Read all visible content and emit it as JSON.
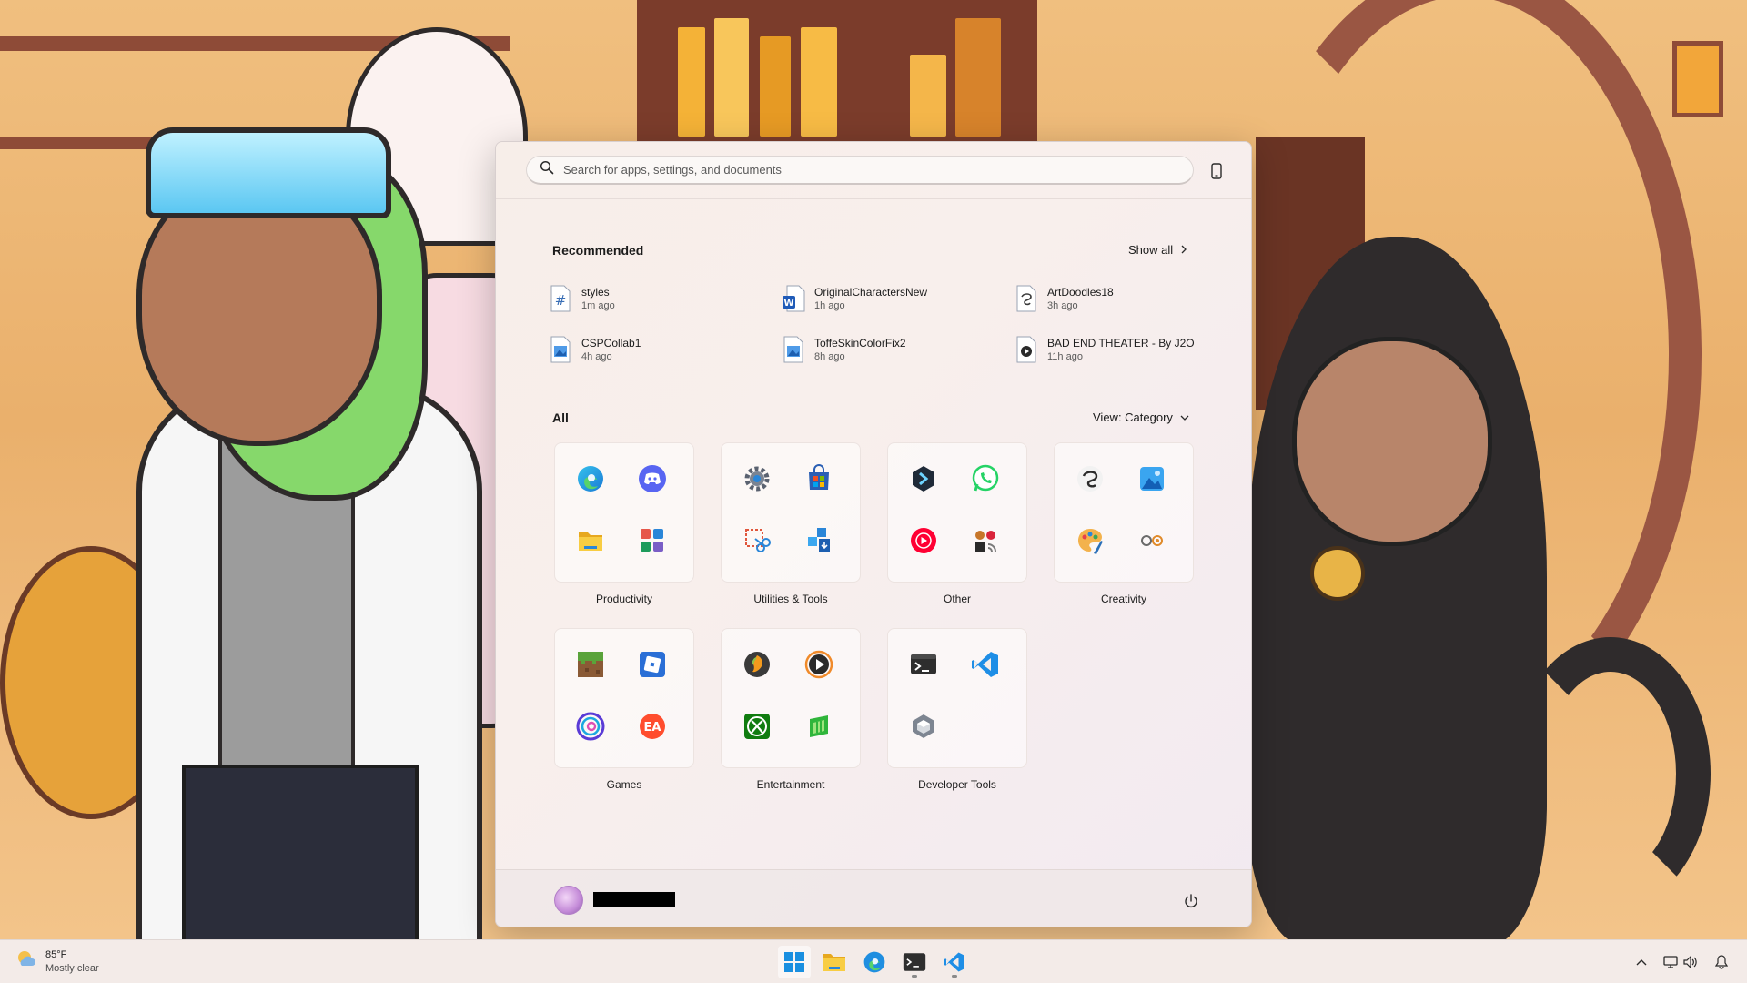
{
  "search": {
    "placeholder": "Search for apps, settings, and documents"
  },
  "recommended": {
    "title": "Recommended",
    "show_all_label": "Show all",
    "items": [
      {
        "name": "styles",
        "time": "1m ago",
        "icon": "hash-file-icon"
      },
      {
        "name": "OriginalCharactersNew",
        "time": "1h ago",
        "icon": "word-document-icon"
      },
      {
        "name": "ArtDoodles18",
        "time": "3h ago",
        "icon": "clip-studio-file-icon"
      },
      {
        "name": "CSPCollab1",
        "time": "4h ago",
        "icon": "image-file-icon"
      },
      {
        "name": "ToffeSkinColorFix2",
        "time": "8h ago",
        "icon": "image-file-icon"
      },
      {
        "name": "BAD END THEATER - By J2O",
        "time": "11h ago",
        "icon": "media-file-icon"
      }
    ]
  },
  "all": {
    "title": "All",
    "view_label": "View: Category",
    "folders": [
      {
        "label": "Productivity",
        "apps": [
          "edge-icon",
          "discord-icon",
          "file-explorer-icon",
          "office-apps-icon"
        ]
      },
      {
        "label": "Utilities & Tools",
        "apps": [
          "settings-gear-icon",
          "microsoft-store-icon",
          "snipping-tool-icon",
          "app-installer-icon"
        ]
      },
      {
        "label": "Other",
        "apps": [
          "proton-icon",
          "whatsapp-icon",
          "youtube-music-icon",
          "misc-apps-icon"
        ]
      },
      {
        "label": "Creativity",
        "apps": [
          "clip-studio-icon",
          "photos-icon",
          "paint-icon",
          "drawing-tools-icon"
        ]
      },
      {
        "label": "Games",
        "apps": [
          "minecraft-icon",
          "roblox-icon",
          "ubisoft-icon",
          "ea-icon"
        ]
      },
      {
        "label": "Entertainment",
        "apps": [
          "fl-studio-icon",
          "media-player-icon",
          "xbox-icon",
          "game-pass-icon"
        ]
      },
      {
        "label": "Developer Tools",
        "apps": [
          "terminal-icon",
          "vscode-icon",
          "unity-icon"
        ]
      }
    ]
  },
  "user": {
    "name": ""
  },
  "taskbar": {
    "weather_temp": "85°F",
    "weather_condition": "Mostly clear",
    "apps": [
      "windows-start-icon",
      "file-explorer-icon",
      "edge-icon",
      "terminal-icon",
      "vscode-icon"
    ]
  },
  "colors": {
    "accent": "#0078d4",
    "taskbar_bg": "#f3ebe8",
    "menu_bg": "#f7eee9"
  }
}
